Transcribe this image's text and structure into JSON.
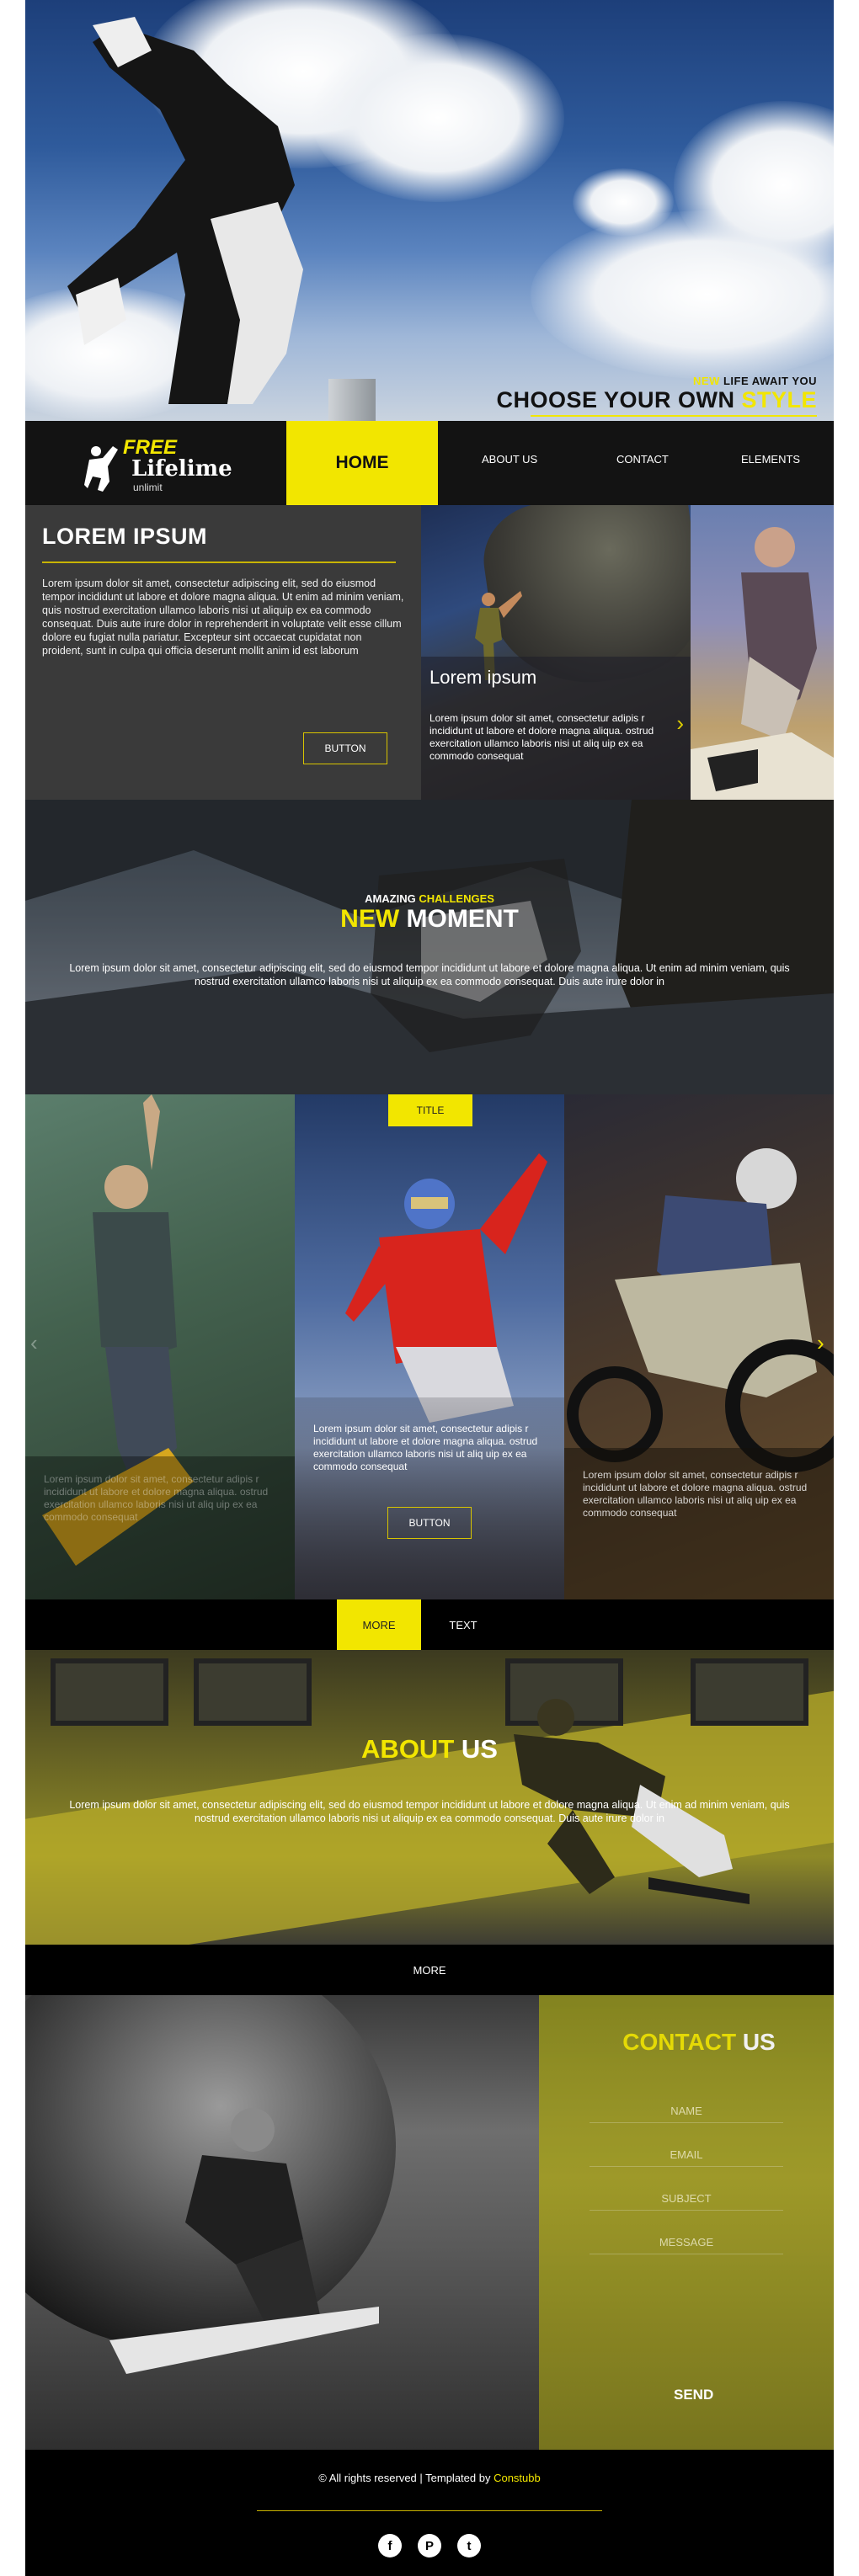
{
  "hero": {
    "tag_new": "NEW",
    "tag_small": " LIFE AWAIT YOU",
    "tag_big_prefix": "CHOOSE YOUR OWN ",
    "tag_big_accent": "STYLE"
  },
  "logo": {
    "free": "FREE",
    "lifelime": "Lifelime",
    "unlimit": "unlimit"
  },
  "nav": {
    "home": "HOME",
    "about": "ABOUT US",
    "contact": "CONTACT",
    "elements": "ELEMENTS"
  },
  "intro": {
    "title": "LOREM IPSUM",
    "body": "Lorem ipsum dolor sit amet, consectetur adipiscing elit, sed do eiusmod tempor incididunt ut labore et dolore magna aliqua. Ut enim ad minim veniam, quis nostrud exercitation ullamco laboris nisi ut aliquip ex ea commodo consequat. Duis aute irure dolor in reprehenderit in voluptate velit esse cillum dolore eu fugiat nulla pariatur. Excepteur sint occaecat cupidatat non proident, sunt in culpa qui officia deserunt mollit anim id est laborum",
    "button": "BUTTON"
  },
  "climb": {
    "title": "Lorem ipsum",
    "body": "Lorem ipsum dolor sit amet, consectetur adipis r incididunt ut labore et dolore magna aliqua. ostrud exercitation ullamco laboris nisi ut aliq uip ex ea commodo consequat",
    "arrow": "›"
  },
  "moment": {
    "small_prefix": "AMAZING ",
    "small_accent": "CHALLENGES",
    "big_accent": "NEW",
    "big_rest": " MOMENT",
    "body": "Lorem ipsum dolor sit amet, consectetur adipiscing elit, sed do eiusmod tempor incididunt ut labore et dolore magna aliqua. Ut enim ad minim veniam, quis nostrud exercitation ullamco laboris nisi ut aliquip ex ea commodo consequat. Duis aute irure dolor in"
  },
  "slider": {
    "title_tab": "TITLE",
    "card1_text": "Lorem ipsum dolor sit amet, consectetur adipis r incididunt ut labore et dolore magna aliqua. ostrud exercitation ullamco laboris nisi ut aliq uip ex ea commodo consequat",
    "card2_text": "Lorem ipsum dolor sit amet, consectetur adipis r incididunt ut labore et dolore magna aliqua. ostrud exercitation ullamco laboris nisi ut aliq uip ex ea commodo consequat",
    "card2_button": "BUTTON",
    "card3_text": "Lorem ipsum dolor sit amet, consectetur adipis r incididunt ut labore et dolore magna aliqua. ostrud exercitation ullamco laboris nisi ut aliq uip ex ea commodo consequat",
    "prev": "‹",
    "next": "›"
  },
  "tabs": {
    "more": "MORE",
    "text": "TEXT"
  },
  "about": {
    "accent": "ABOUT",
    "rest": " US",
    "body": "Lorem ipsum dolor sit amet, consectetur adipiscing elit, sed do eiusmod tempor incididunt ut labore et dolore magna aliqua. Ut enim ad minim veniam, quis nostrud exercitation ullamco laboris nisi ut aliquip ex ea commodo consequat. Duis aute irure dolor in",
    "more": "MORE"
  },
  "contact": {
    "accent": "CONTACT",
    "rest": " US",
    "name": "NAME",
    "email": "EMAIL",
    "subject": "SUBJECT",
    "message": "MESSAGE",
    "send": "SEND"
  },
  "footer": {
    "copyright_symbol": "©",
    "rights": " All rights reserved  |  Templated by ",
    "author": "Constubb",
    "social": [
      "f",
      "P",
      "t"
    ]
  },
  "colors": {
    "accent": "#f2e600",
    "dark": "#111111"
  }
}
